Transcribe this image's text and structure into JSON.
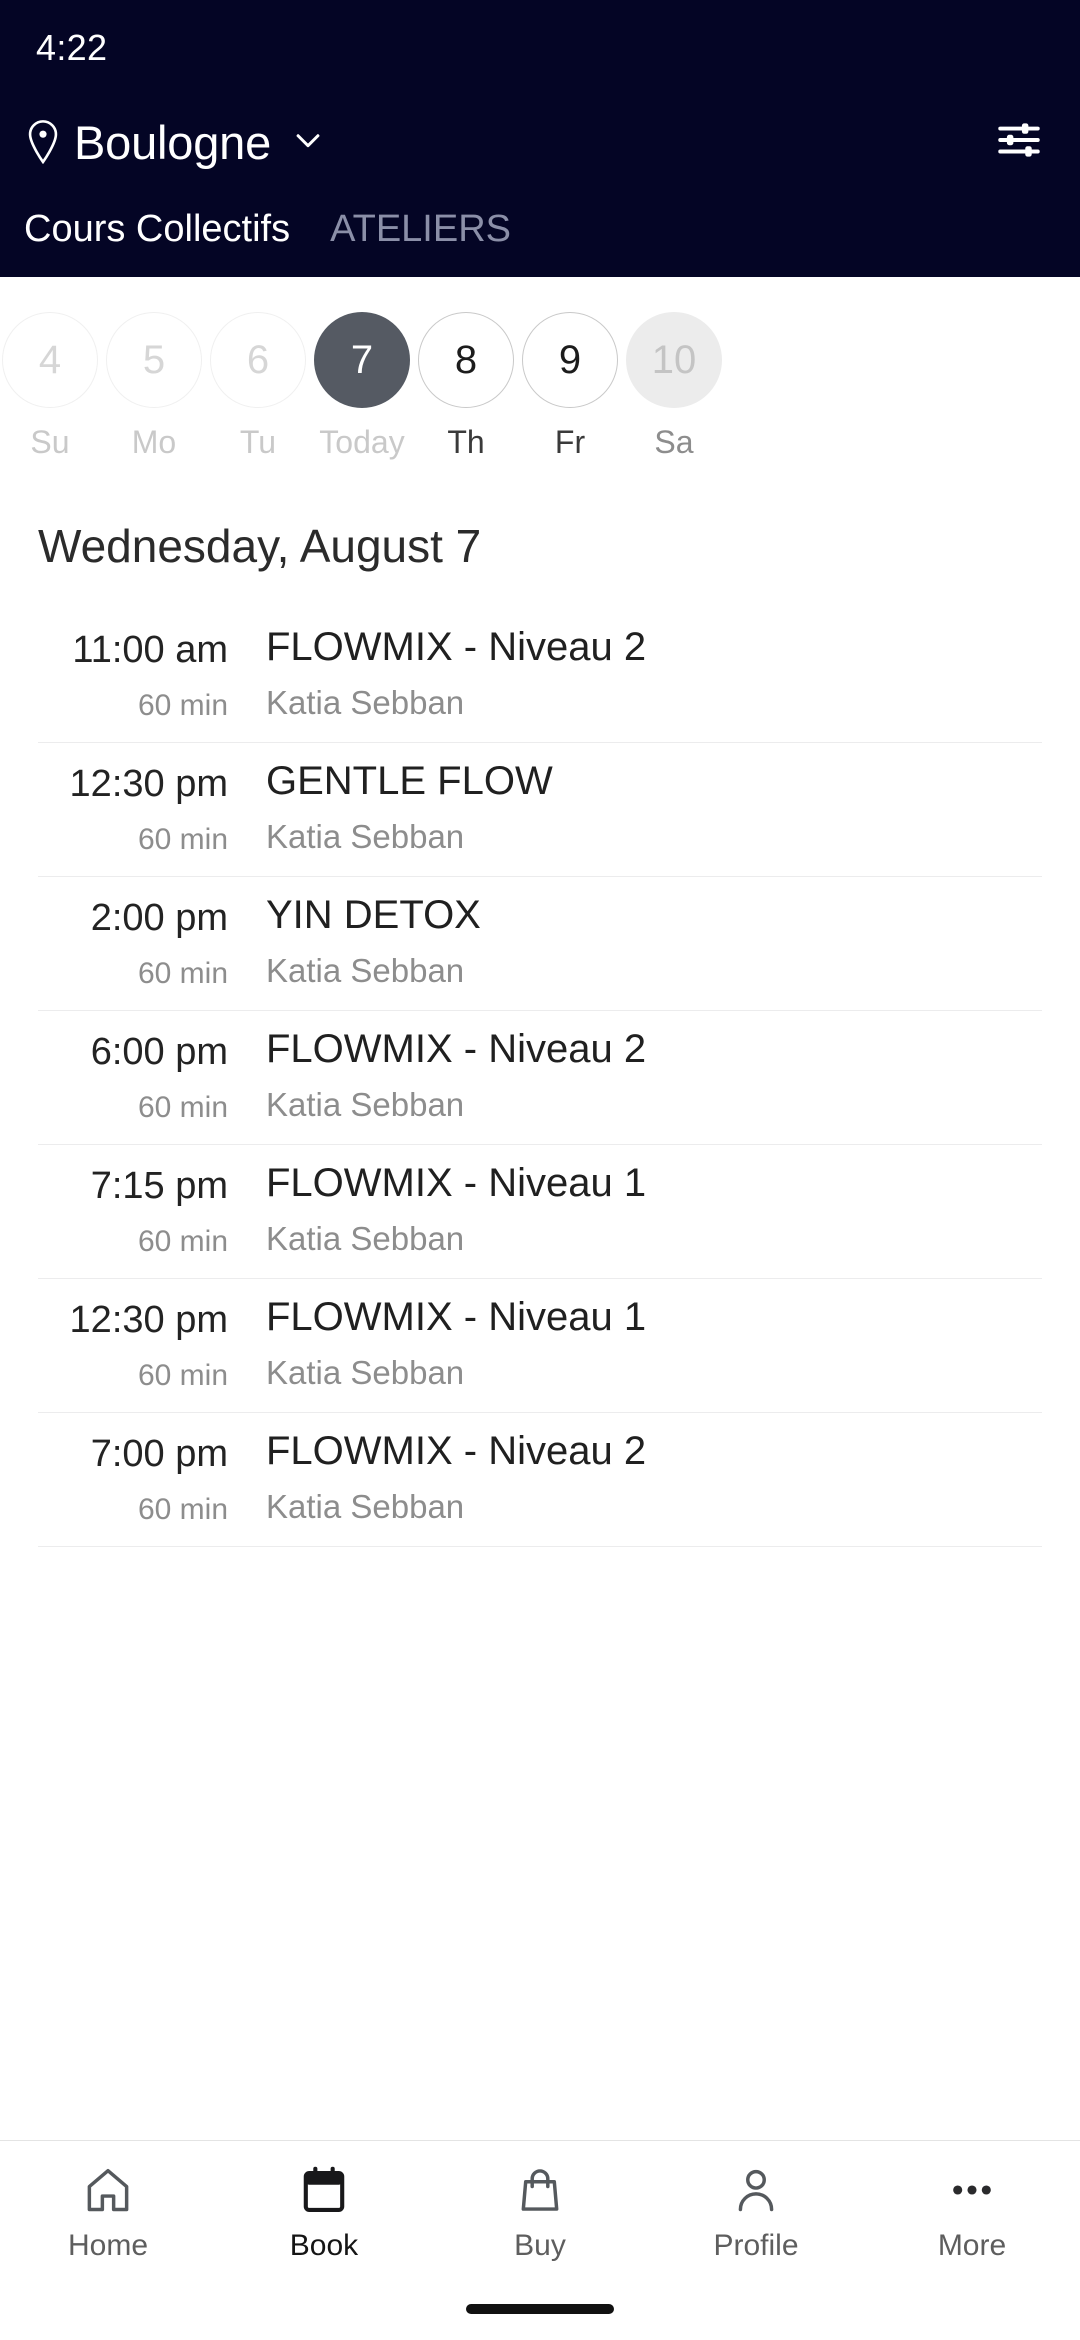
{
  "status_bar": {
    "time": "4:22"
  },
  "header": {
    "location": "Boulogne",
    "location_chevron_icon": "chevron-down-icon",
    "pin_icon": "location-pin-icon",
    "filter_icon": "tune-filter-icon",
    "bg_color": "#040525",
    "tabs": [
      {
        "label": "Cours Collectifs",
        "active": true
      },
      {
        "label": "ATELIERS",
        "active": false
      }
    ]
  },
  "date_strip": {
    "days": [
      {
        "num": "4",
        "label": "Su",
        "state": "past"
      },
      {
        "num": "5",
        "label": "Mo",
        "state": "past"
      },
      {
        "num": "6",
        "label": "Tu",
        "state": "past"
      },
      {
        "num": "7",
        "label": "Today",
        "state": "today"
      },
      {
        "num": "8",
        "label": "Th",
        "state": "future"
      },
      {
        "num": "9",
        "label": "Fr",
        "state": "future"
      },
      {
        "num": "10",
        "label": "Sa",
        "state": "disabled"
      }
    ],
    "today_fill_color": "#555a63"
  },
  "schedule": {
    "date_heading": "Wednesday, August 7",
    "rows": [
      {
        "time": "11:00 am",
        "duration": "60 min",
        "title": "FLOWMIX - Niveau 2",
        "teacher": "Katia Sebban"
      },
      {
        "time": "12:30 pm",
        "duration": "60 min",
        "title": "GENTLE FLOW",
        "teacher": "Katia Sebban"
      },
      {
        "time": "2:00 pm",
        "duration": "60 min",
        "title": "YIN DETOX",
        "teacher": "Katia Sebban"
      },
      {
        "time": "6:00 pm",
        "duration": "60 min",
        "title": "FLOWMIX - Niveau 2",
        "teacher": "Katia Sebban"
      },
      {
        "time": "7:15 pm",
        "duration": "60 min",
        "title": "FLOWMIX - Niveau 1",
        "teacher": "Katia Sebban"
      },
      {
        "time": "12:30 pm",
        "duration": "60 min",
        "title": "FLOWMIX - Niveau 1",
        "teacher": "Katia Sebban"
      },
      {
        "time": "7:00 pm",
        "duration": "60 min",
        "title": "FLOWMIX - Niveau 2",
        "teacher": "Katia Sebban"
      }
    ]
  },
  "bottom_nav": {
    "items": [
      {
        "label": "Home",
        "icon": "home-icon",
        "active": false
      },
      {
        "label": "Book",
        "icon": "calendar-icon",
        "active": true
      },
      {
        "label": "Buy",
        "icon": "bag-icon",
        "active": false
      },
      {
        "label": "Profile",
        "icon": "person-icon",
        "active": false
      },
      {
        "label": "More",
        "icon": "ellipsis-icon",
        "active": false
      }
    ]
  }
}
